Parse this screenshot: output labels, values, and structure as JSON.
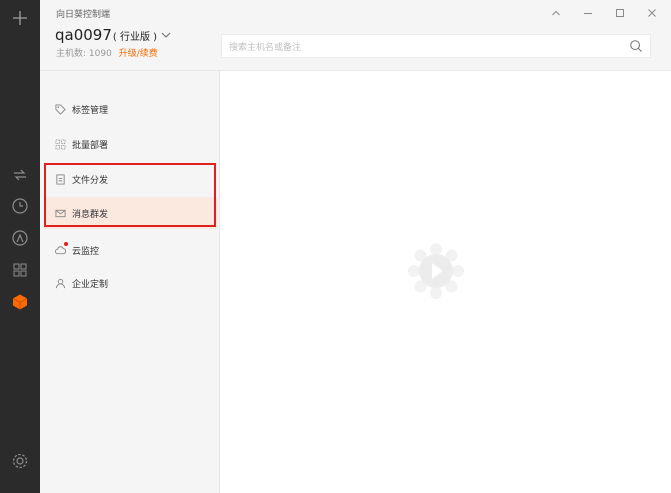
{
  "app": {
    "title": "向日葵控制端"
  },
  "account": {
    "name": "qa0097",
    "edition": "( 行业版 )",
    "host_label": "主机数: 1090",
    "upgrade_label": "升级/续费"
  },
  "search": {
    "placeholder": "搜索主机名或备注",
    "value": ""
  },
  "window_controls": [
    "collapse",
    "minimize",
    "maximize",
    "close"
  ],
  "rail": {
    "icons": [
      "add-icon",
      "remote-connect-icon",
      "history-clock-icon",
      "discover-icon",
      "apps-grid-icon",
      "cube-icon",
      "settings-icon"
    ],
    "active": "cube-icon"
  },
  "menu": {
    "items": [
      {
        "label": "标签管理",
        "icon": "tag-icon"
      },
      {
        "label": "批量部署",
        "icon": "batch-deploy-icon"
      },
      {
        "label": "文件分发",
        "icon": "file-distribute-icon"
      },
      {
        "label": "消息群发",
        "icon": "message-mail-icon"
      },
      {
        "label": "云监控",
        "icon": "cloud-monitor-icon"
      },
      {
        "label": "企业定制",
        "icon": "enterprise-user-icon"
      }
    ],
    "active_index": 3
  },
  "colors": {
    "accent": "#ff6a00",
    "rail": "#2b2b2b",
    "highlight": "#e02020",
    "active_bg": "#fbe8df"
  }
}
